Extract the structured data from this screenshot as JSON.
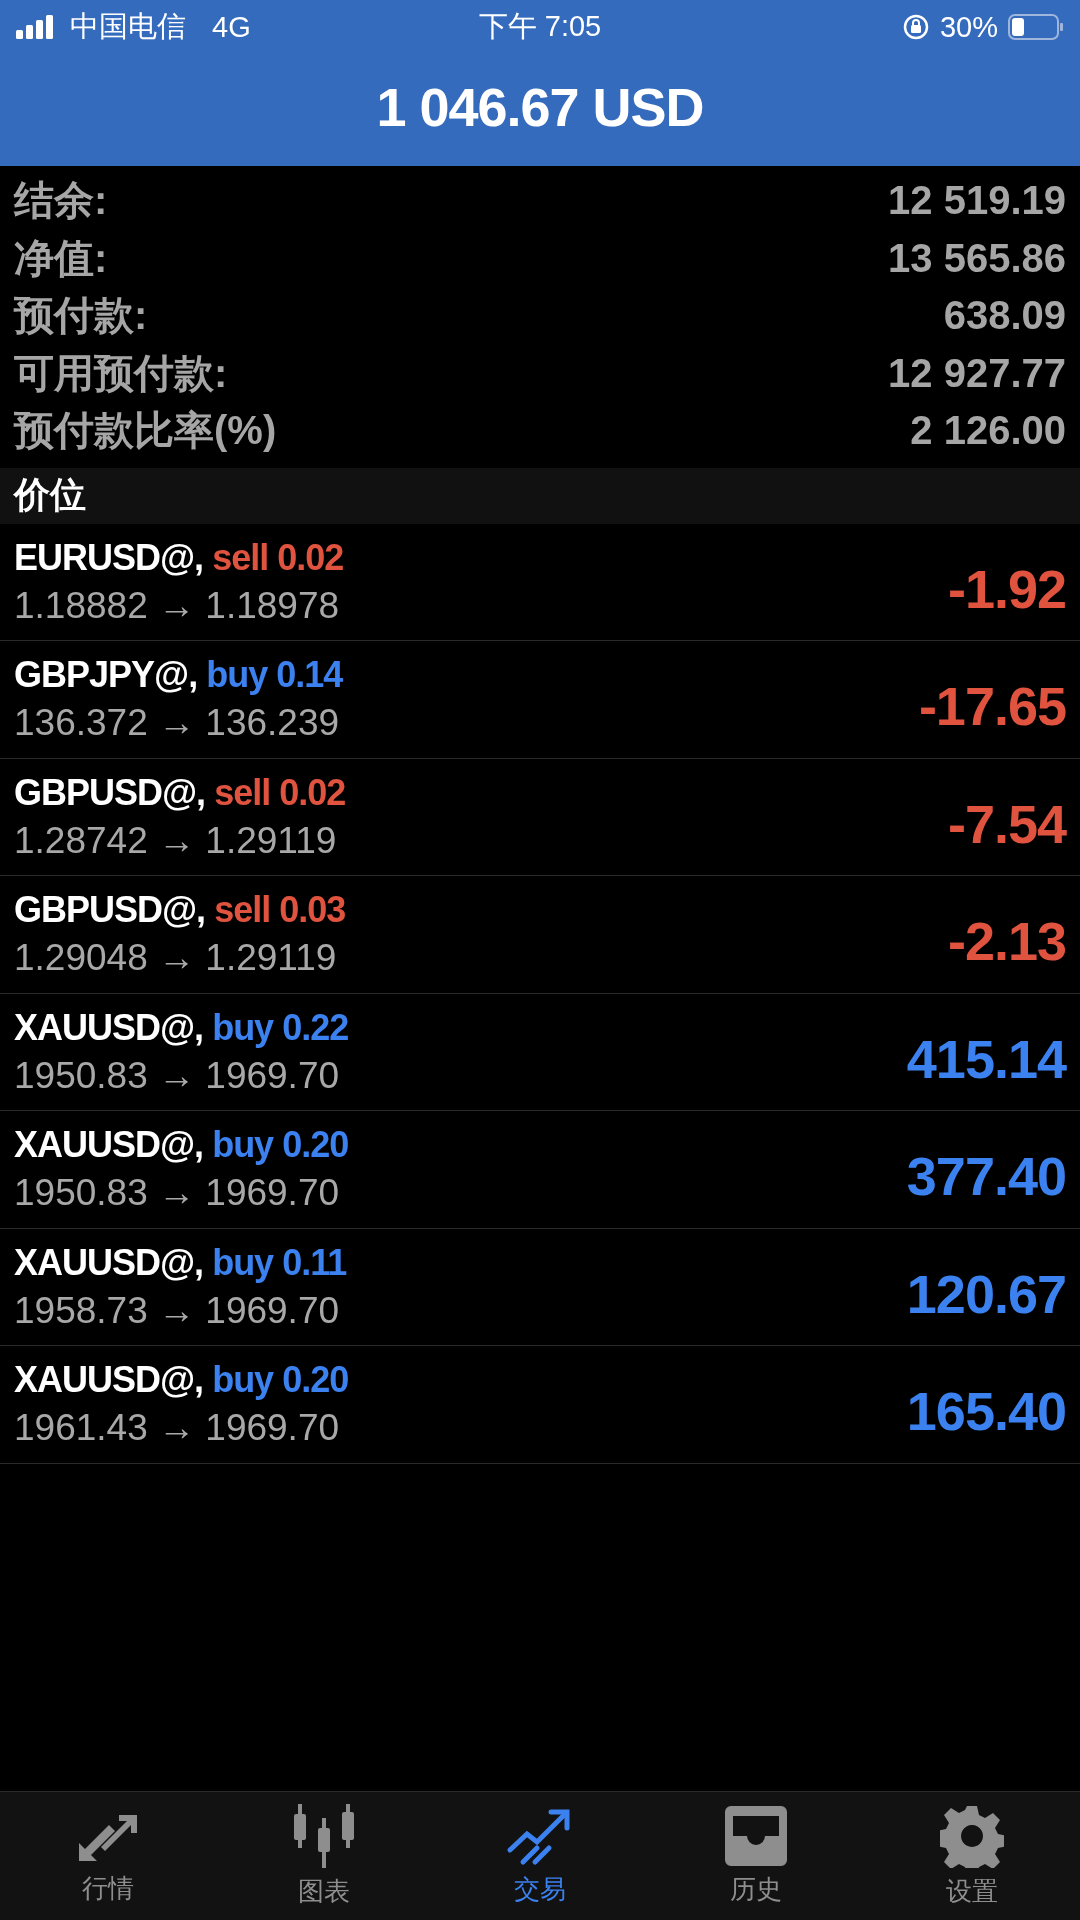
{
  "status_bar": {
    "carrier": "中国电信",
    "network": "4G",
    "time": "下午 7:05",
    "battery": "30%"
  },
  "header": {
    "title": "1 046.67 USD"
  },
  "summary": [
    {
      "label": "结余:",
      "value": "12 519.19"
    },
    {
      "label": "净值:",
      "value": "13 565.86"
    },
    {
      "label": "预付款:",
      "value": "638.09"
    },
    {
      "label": "可用预付款:",
      "value": "12 927.77"
    },
    {
      "label": "预付款比率(%)",
      "value": "2 126.00"
    }
  ],
  "section": {
    "title": "价位"
  },
  "positions": [
    {
      "symbol": "EURUSD@,",
      "kind": "sell",
      "order": "sell 0.02",
      "prices": "1.18882 → 1.18978",
      "profit": "-1.92",
      "loss": true
    },
    {
      "symbol": "GBPJPY@,",
      "kind": "buy",
      "order": "buy 0.14",
      "prices": "136.372 → 136.239",
      "profit": "-17.65",
      "loss": true
    },
    {
      "symbol": "GBPUSD@,",
      "kind": "sell",
      "order": "sell 0.02",
      "prices": "1.28742 → 1.29119",
      "profit": "-7.54",
      "loss": true
    },
    {
      "symbol": "GBPUSD@,",
      "kind": "sell",
      "order": "sell 0.03",
      "prices": "1.29048 → 1.29119",
      "profit": "-2.13",
      "loss": true
    },
    {
      "symbol": "XAUUSD@,",
      "kind": "buy",
      "order": "buy 0.22",
      "prices": "1950.83 → 1969.70",
      "profit": "415.14",
      "loss": false
    },
    {
      "symbol": "XAUUSD@,",
      "kind": "buy",
      "order": "buy 0.20",
      "prices": "1950.83 → 1969.70",
      "profit": "377.40",
      "loss": false
    },
    {
      "symbol": "XAUUSD@,",
      "kind": "buy",
      "order": "buy 0.11",
      "prices": "1958.73 → 1969.70",
      "profit": "120.67",
      "loss": false
    },
    {
      "symbol": "XAUUSD@,",
      "kind": "buy",
      "order": "buy 0.20",
      "prices": "1961.43 → 1969.70",
      "profit": "165.40",
      "loss": false
    }
  ],
  "tab_bar": [
    {
      "label": "行情",
      "selected": false
    },
    {
      "label": "图表",
      "selected": false
    },
    {
      "label": "交易",
      "selected": true
    },
    {
      "label": "历史",
      "selected": false
    },
    {
      "label": "设置",
      "selected": false
    }
  ]
}
